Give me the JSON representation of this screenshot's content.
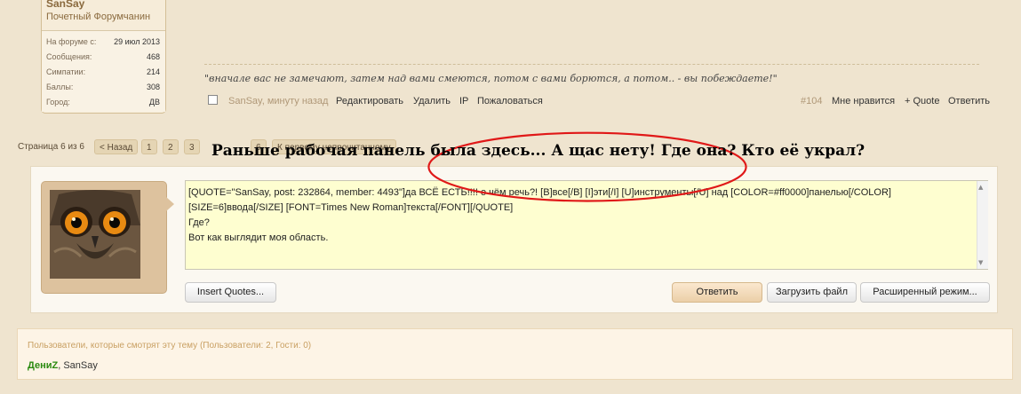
{
  "user": {
    "name": "SanSay",
    "title": "Почетный Форумчанин",
    "stats": [
      {
        "label": "На форуме с:",
        "value": "29 июл 2013"
      },
      {
        "label": "Сообщения:",
        "value": "468"
      },
      {
        "label": "Симпатии:",
        "value": "214"
      },
      {
        "label": "Баллы:",
        "value": "308"
      },
      {
        "label": "Город:",
        "value": "ДВ"
      }
    ]
  },
  "signature": "\"вначале вас не замечают, затем над вами смеются, потом с вами борются, а потом.. - вы побеждаете!\"",
  "post_controls": {
    "meta": "SanSay, минуту назад",
    "edit": "Редактировать",
    "delete": "Удалить",
    "ip": "IP",
    "report": "Пожаловаться",
    "number": "#104",
    "like": "Мне нравится",
    "quote": "+ Quote",
    "reply": "Ответить"
  },
  "pagination": {
    "label": "Страница 6 из 6",
    "prev": "< Назад",
    "pages": [
      "1",
      "2",
      "3",
      "6"
    ],
    "first_unread": "К первому непрочитанному"
  },
  "annotation": "Раньше рабочая панель была здесь... А щас нету! Где она? Кто её украл?",
  "editor": {
    "lines": [
      "[QUOTE=\"SanSay, post: 232864, member: 4493\"]да ВСЁ ЕСТЬ!!!! о чём речь?! [B]все[/B] [I]эти[/I] [U]инструменты[/U] над [COLOR=#ff0000]панелью[/COLOR]",
      "[SIZE=6]ввода[/SIZE] [FONT=Times New Roman]текста[/FONT][/QUOTE]",
      "Где?",
      "Вот как выглядит моя область."
    ]
  },
  "buttons": {
    "insert_quotes": "Insert Quotes...",
    "reply": "Ответить",
    "upload": "Загрузить файл",
    "advanced": "Расширенный режим..."
  },
  "online": {
    "header": "Пользователи, которые смотрят эту тему (Пользователи: 2, Гости: 0)",
    "users": [
      "ДениZ",
      "SanSay"
    ],
    "separator": ", "
  },
  "colors": {
    "page_bg": "#efe4cf",
    "annotation_ellipse": "#e01818",
    "admin_user": "#2a8a10"
  }
}
